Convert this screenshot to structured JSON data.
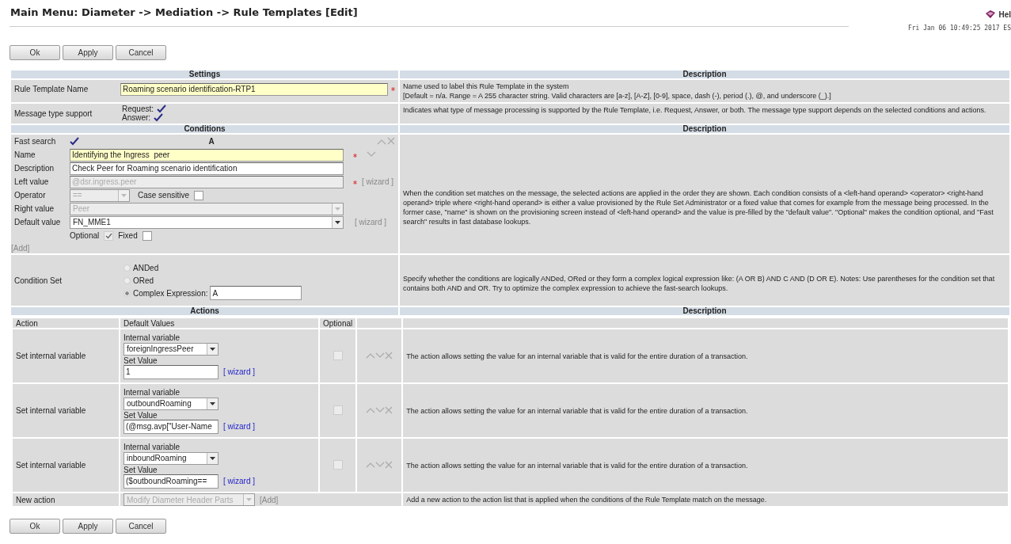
{
  "title": "Main Menu: Diameter -> Mediation -> Rule Templates [Edit]",
  "help": "Hel",
  "timestamp": "Fri Jan 06 10:49:25 2017 ES",
  "buttons": [
    "Ok",
    "Apply",
    "Cancel"
  ],
  "settings": {
    "heading": "Settings",
    "desc_heading": "Description",
    "name": {
      "label": "Rule Template Name",
      "value": "Roaming scenario identification-RTP1",
      "required": true,
      "description_lines": [
        "Name used to label this Rule Template in the system",
        "[Default = n/a. Range = A 255 character string. Valid characters are [a-z], [A-Z], [0-9], space, dash (-), period (.), @, and underscore (_).]"
      ]
    },
    "message_type": {
      "label": "Message type support",
      "options": [
        {
          "label": "Request:",
          "checked": true
        },
        {
          "label": "Answer:",
          "checked": true
        }
      ],
      "description": "Indicates what type of message processing is supported by the Rule Template, i.e. Request, Answer, or both. The message type support depends on the selected conditions and actions."
    }
  },
  "conditions": {
    "heading": "Conditions",
    "desc_heading": "Description",
    "fast_search": {
      "label": "Fast search",
      "checked": true
    },
    "column": "A",
    "fields": [
      {
        "label": "Name",
        "kind": "text",
        "value": "Identifying the Ingress  peer",
        "required": true,
        "disabled": false
      },
      {
        "label": "Description",
        "kind": "text",
        "value": "Check Peer for Roaming scenario identification",
        "required": false,
        "disabled": false
      },
      {
        "label": "Left value",
        "kind": "text",
        "value": "@dsr.ingress.peer",
        "required": true,
        "disabled": true,
        "wizard": "[ wizard ]"
      },
      {
        "label": "Operator",
        "kind": "operator",
        "value": "==",
        "disabled": true,
        "case_label": "Case sensitive",
        "case_checked": false
      },
      {
        "label": "Right value",
        "kind": "select",
        "value": "Peer",
        "disabled": true
      },
      {
        "label": "Default value",
        "kind": "select",
        "value": "FN_MME1",
        "disabled": false,
        "wizard": "[ wizard ]"
      }
    ],
    "optional": {
      "label": "Optional",
      "checked": true
    },
    "fixed": {
      "label": "Fixed",
      "checked": false
    },
    "add": "[Add]",
    "description": "When the condition set matches on the message, the selected actions are applied in the order they are shown. Each condition consists of a <left-hand operand> <operator> <right-hand operand> triple where <right-hand operand> is either a value provisioned by the Rule Set Administrator or a fixed value that comes for example from the message being processed. In the former case, \"name\" is shown on the provisioning screen instead of <left-hand operand> and the value is pre-filled by the \"default value\". \"Optional\" makes the condition optional, and \"Fast search\" results in fast database lookups."
  },
  "condition_set": {
    "label": "Condition Set",
    "options": [
      {
        "label": "ANDed",
        "selected": false
      },
      {
        "label": "ORed",
        "selected": false
      },
      {
        "label": "Complex Expression:",
        "selected": true,
        "value": "A"
      }
    ],
    "description": "Specify whether the conditions are logically ANDed, ORed or they form a complex logical expression like: (A OR B) AND C AND (D OR E). Notes: Use parentheses for the condition set that contains both AND and OR. Try to optimize the complex expression to achieve the fast-search lookups."
  },
  "actions": {
    "heading": "Actions",
    "desc_heading": "Description",
    "columns": [
      "Action",
      "Default Values",
      "Optional"
    ],
    "rows": [
      {
        "action": "Set internal variable",
        "variable_label": "Internal variable",
        "variable": "foreignIngressPeer",
        "value_label": "Set Value",
        "value": "1",
        "wizard": "[ wizard ]",
        "optional": false,
        "description": "The action allows setting the value for an internal variable that is valid for the entire duration of a transaction."
      },
      {
        "action": "Set internal variable",
        "variable_label": "Internal variable",
        "variable": "outboundRoaming",
        "value_label": "Set Value",
        "value": "(@msg.avp[\"User-Name",
        "wizard": "[ wizard ]",
        "optional": false,
        "description": "The action allows setting the value for an internal variable that is valid for the entire duration of a transaction."
      },
      {
        "action": "Set internal variable",
        "variable_label": "Internal variable",
        "variable": "inboundRoaming",
        "value_label": "Set Value",
        "value": "($outboundRoaming==",
        "wizard": "[ wizard ]",
        "optional": false,
        "description": "The action allows setting the value for an internal variable that is valid for the entire duration of a transaction."
      }
    ],
    "new_action": {
      "label": "New action",
      "value": "Modify Diameter Header Parts",
      "add": "[Add]",
      "description": "Add a new action to the action list that is applied when the conditions of the Rule Template match on the message."
    }
  },
  "bottom_buttons": [
    "Ok",
    "Apply",
    "Cancel"
  ]
}
